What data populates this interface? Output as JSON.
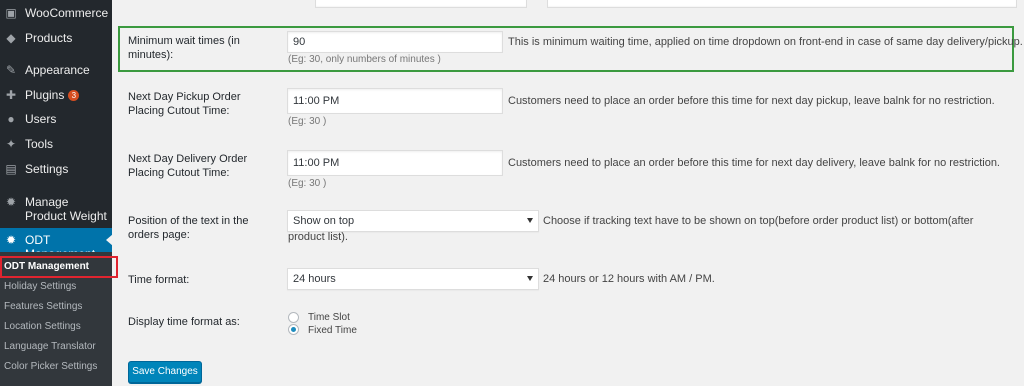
{
  "sidebar": {
    "items": [
      {
        "label": "WooCommerce",
        "icon": "woocommerce-icon",
        "glyph": "▣"
      },
      {
        "label": "Products",
        "icon": "products-icon",
        "glyph": "◆"
      },
      {
        "label": "Appearance",
        "icon": "appearance-icon",
        "glyph": "✎"
      },
      {
        "label": "Plugins",
        "icon": "plugins-icon",
        "glyph": "✚",
        "badge": "3"
      },
      {
        "label": "Users",
        "icon": "users-icon",
        "glyph": "●"
      },
      {
        "label": "Tools",
        "icon": "tools-icon",
        "glyph": "✦"
      },
      {
        "label": "Settings",
        "icon": "settings-icon",
        "glyph": "▤"
      },
      {
        "label": "Manage Product Weight",
        "icon": "gear-icon",
        "glyph": "✹"
      },
      {
        "label": "ODT Management",
        "icon": "gear-icon",
        "glyph": "✹"
      }
    ],
    "submenu": [
      "ODT Management",
      "Holiday Settings",
      "Features Settings",
      "Location Settings",
      "Language Translator",
      "Color Picker Settings"
    ]
  },
  "form": {
    "min_wait": {
      "label": "Minimum wait times (in minutes):",
      "value": "90",
      "desc": "This is minimum waiting time, applied on time dropdown on front-end in case of same day delivery/pickup.",
      "hint": "(Eg: 30, only numbers of minutes )"
    },
    "pickup_cutoff": {
      "label": "Next Day Pickup Order Placing Cutout Time:",
      "value": "11:00 PM",
      "desc": "Customers need to place an order before this time for next day pickup, leave balnk for no restriction.",
      "hint": "(Eg: 30 )"
    },
    "delivery_cutoff": {
      "label": "Next Day Delivery Order Placing Cutout Time:",
      "value": "11:00 PM",
      "desc": "Customers need to place an order before this time for next day delivery, leave balnk for no restriction.",
      "hint": "(Eg: 30 )"
    },
    "text_position": {
      "label": "Position of the text in the orders page:",
      "selected": "Show on top",
      "desc": "Choose if tracking text have to be shown on top(before order product list) or bottom(after product list)."
    },
    "time_format": {
      "label": "Time format:",
      "selected": "24 hours",
      "desc": "24 hours or 12 hours with AM / PM."
    },
    "display_format": {
      "label": "Display time format as:",
      "options": [
        "Time Slot",
        "Fixed Time"
      ],
      "checked": "Fixed Time"
    },
    "save_label": "Save Changes"
  },
  "colors": {
    "sidebar_bg": "#23282d",
    "active_bg": "#0073aa",
    "highlight_border": "#3b9a3f",
    "current_sub_border": "#e0242f",
    "button_bg": "#0085ba"
  }
}
